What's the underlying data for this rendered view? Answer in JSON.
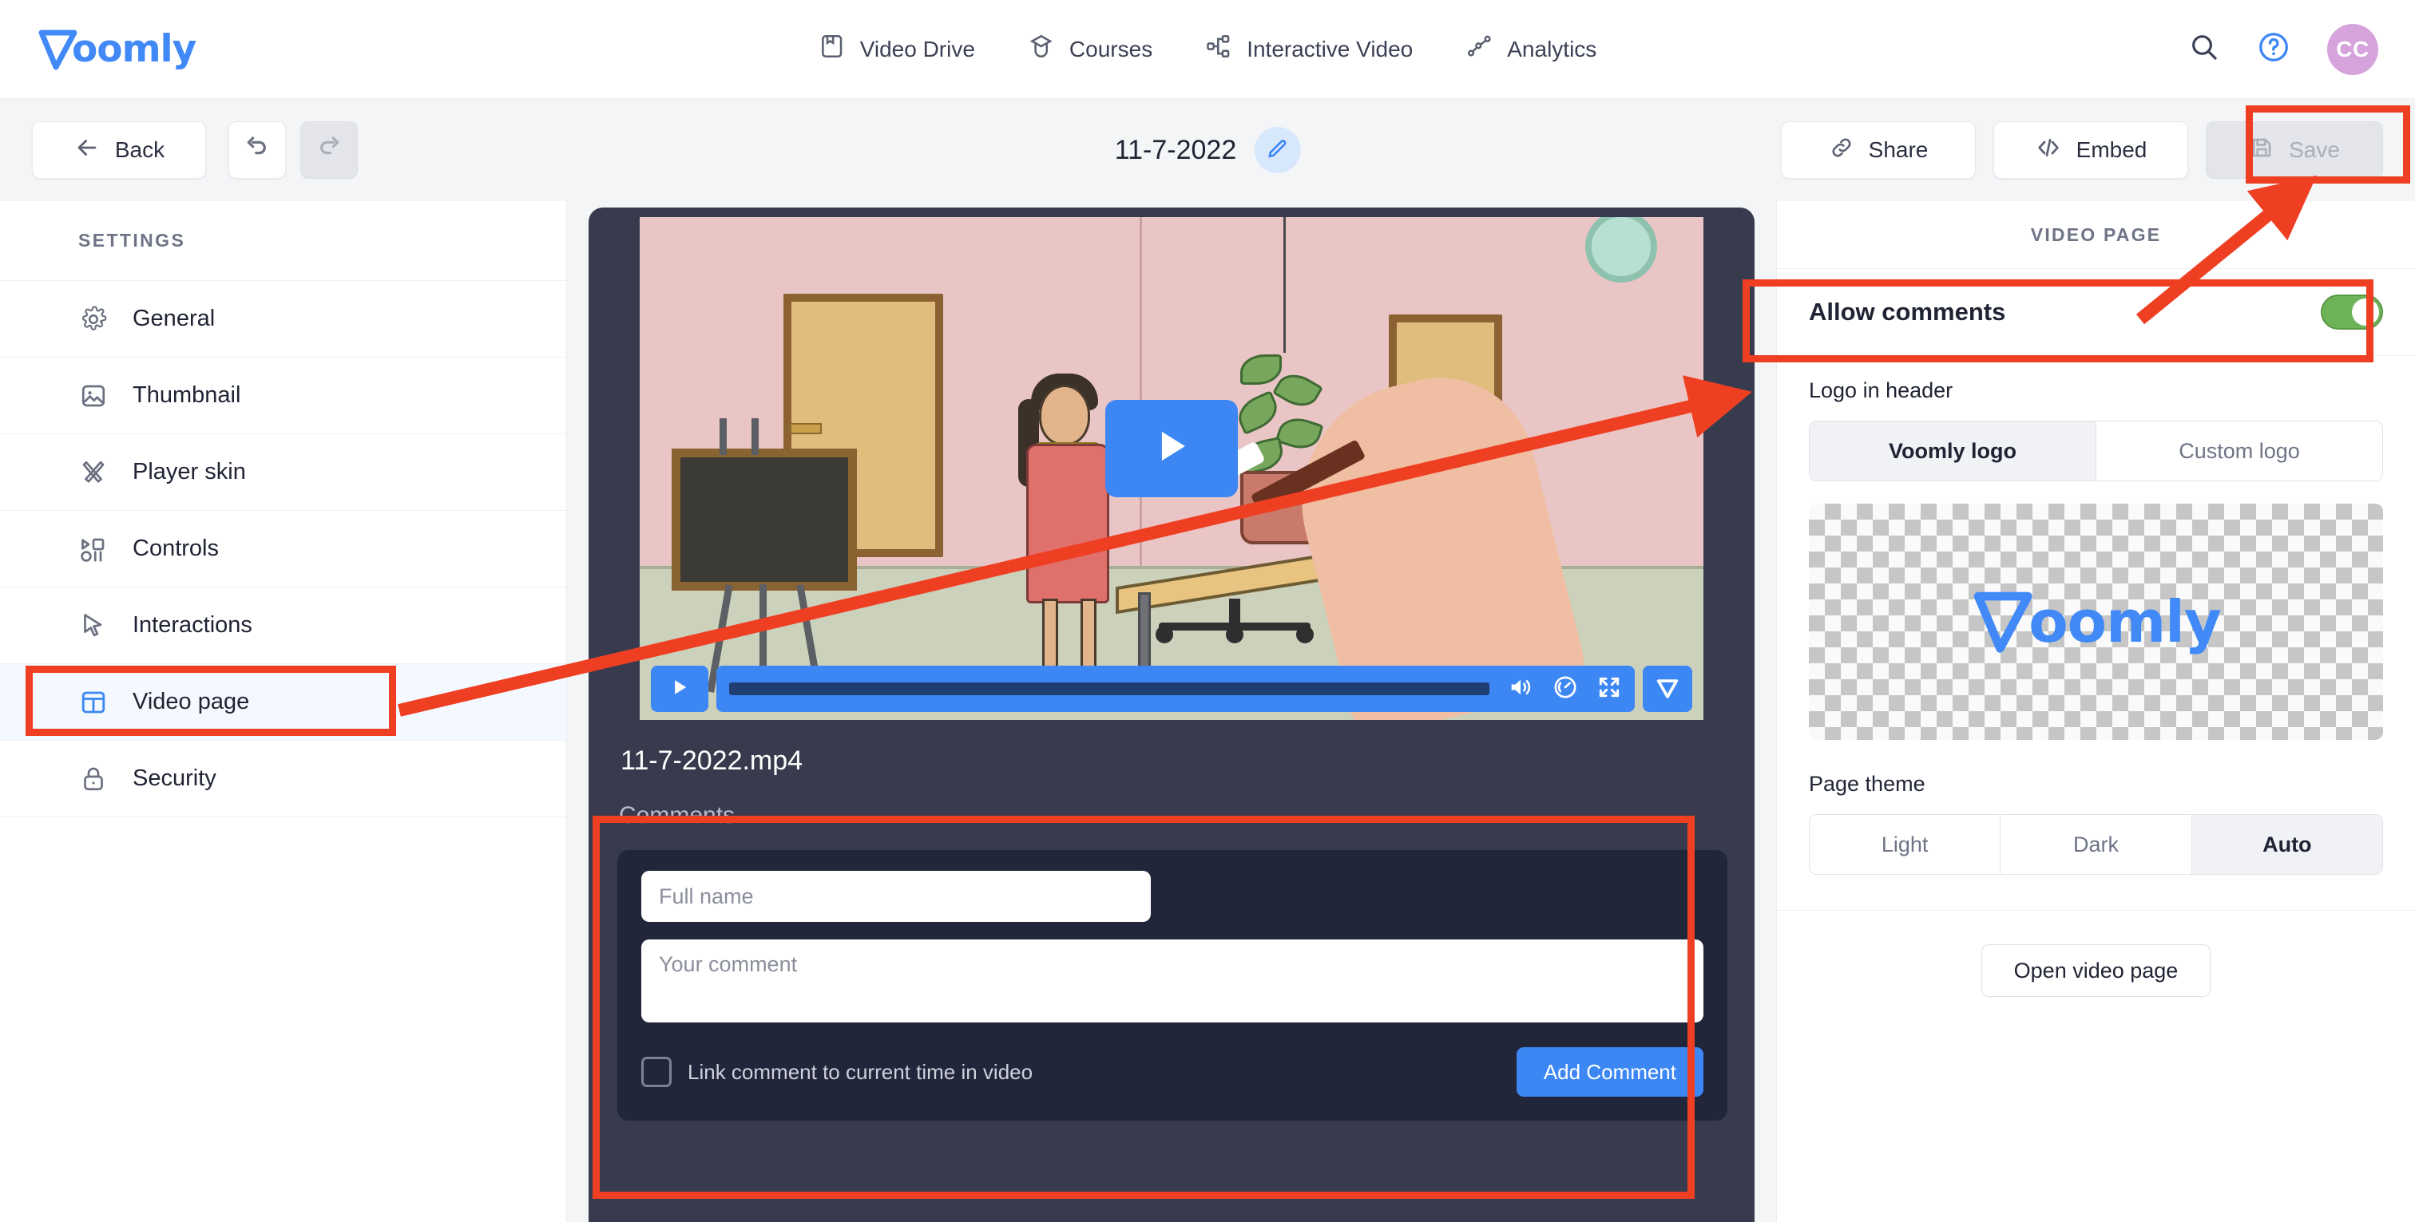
{
  "brand": {
    "name": "Voomly",
    "logo_word": "oomly",
    "accent": "#4189f7"
  },
  "topnav": {
    "items": [
      {
        "label": "Video Drive",
        "icon": "video-drive-icon"
      },
      {
        "label": "Courses",
        "icon": "graduation-cap-icon"
      },
      {
        "label": "Interactive Video",
        "icon": "node-tree-icon"
      },
      {
        "label": "Analytics",
        "icon": "line-chart-icon"
      }
    ],
    "search_icon": "search-icon",
    "help_icon": "help-circle-icon",
    "avatar_initials": "CC",
    "avatar_color": "#d6a3dd"
  },
  "toolbar": {
    "back_label": "Back",
    "undo_icon": "undo-icon",
    "redo_icon": "redo-icon",
    "redo_disabled": true,
    "title": "11-7-2022",
    "edit_icon": "pencil-icon",
    "share_label": "Share",
    "share_icon": "link-icon",
    "embed_label": "Embed",
    "embed_icon": "code-brackets-icon",
    "save_label": "Save",
    "save_icon": "floppy-disk-icon",
    "save_disabled": true
  },
  "sidebar": {
    "header": "SETTINGS",
    "items": [
      {
        "label": "General",
        "icon": "gear-icon",
        "active": false
      },
      {
        "label": "Thumbnail",
        "icon": "image-icon",
        "active": false
      },
      {
        "label": "Player skin",
        "icon": "brushes-icon",
        "active": false
      },
      {
        "label": "Controls",
        "icon": "play-pause-icon",
        "active": false
      },
      {
        "label": "Interactions",
        "icon": "cursor-arrow-icon",
        "active": false
      },
      {
        "label": "Video page",
        "icon": "layout-icon",
        "active": true
      },
      {
        "label": "Security",
        "icon": "lock-icon",
        "active": false
      }
    ]
  },
  "player": {
    "filename": "11-7-2022.mp4",
    "play_icon": "play-icon",
    "volume_icon": "volume-icon",
    "speed_icon": "speed-gauge-icon",
    "fullscreen_icon": "fullscreen-icon",
    "brand_icon": "voomly-mark-icon",
    "progress_percent": 100
  },
  "comments": {
    "title": "Comments",
    "name_placeholder": "Full name",
    "name_value": "",
    "comment_placeholder": "Your comment",
    "comment_value": "",
    "checkbox_label": "Link comment to current time in video",
    "checkbox_checked": false,
    "submit_label": "Add Comment"
  },
  "right_panel": {
    "header": "VIDEO PAGE",
    "allow_comments_label": "Allow comments",
    "allow_comments_on": true,
    "toggle_color": "#6fb359",
    "logo_label": "Logo in header",
    "logo_options": [
      {
        "label": "Voomly logo",
        "selected": true
      },
      {
        "label": "Custom logo",
        "selected": false
      }
    ],
    "theme_label": "Page theme",
    "theme_options": [
      {
        "label": "Light",
        "selected": false
      },
      {
        "label": "Dark",
        "selected": false
      },
      {
        "label": "Auto",
        "selected": true
      }
    ],
    "open_button": "Open video page"
  },
  "annotations": {
    "color": "#ef3f23",
    "boxes": [
      {
        "target": "save-button"
      },
      {
        "target": "allow-comments-row"
      },
      {
        "target": "sidebar-item-video-page"
      },
      {
        "target": "comments-section"
      }
    ],
    "arrows": [
      {
        "from": "sidebar-item-video-page",
        "to": "video-player-right-edge"
      },
      {
        "from": "allow-comments-row",
        "to": "save-button"
      }
    ]
  }
}
